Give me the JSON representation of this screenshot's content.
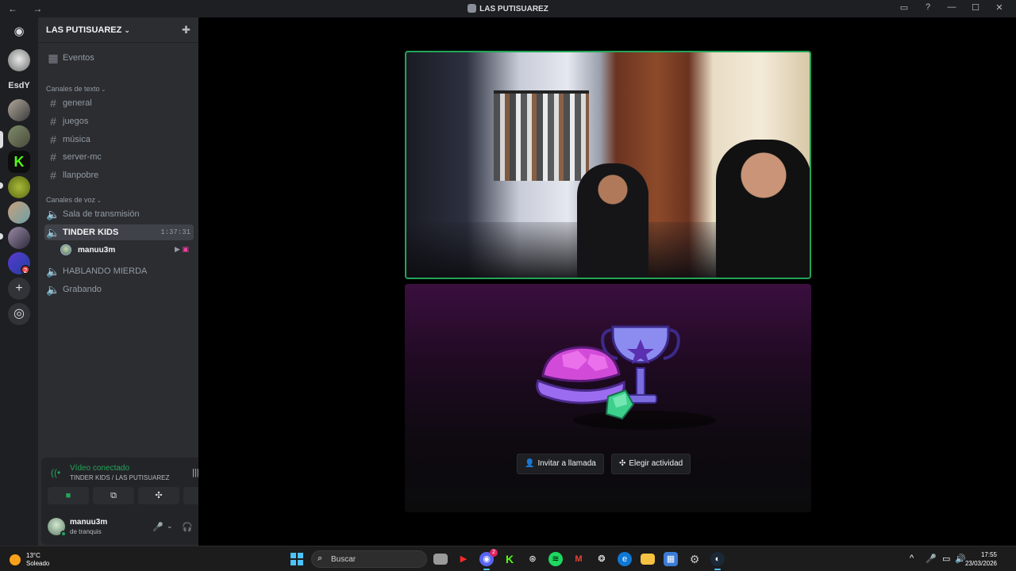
{
  "window": {
    "title": "LAS PUTISUAREZ",
    "nav_glyphs": "← →",
    "controls": {
      "inbox": "▭",
      "help": "?",
      "minimize": "—",
      "maximize": "☐",
      "close": "✕"
    }
  },
  "rail": {
    "home_icon": "◉",
    "folder_label": "EsdY",
    "add_icon": "+",
    "discover_icon": "◎",
    "badge_count": "2"
  },
  "server": {
    "name": "LAS PUTISUAREZ",
    "chevron": "⌄",
    "add_member_icon": "✚",
    "events": {
      "icon": "▦",
      "label": "Eventos"
    }
  },
  "text_category": {
    "label": "Canales de texto",
    "chevron": "⌄"
  },
  "text_channels": [
    {
      "icon": "#",
      "label": "general"
    },
    {
      "icon": "#",
      "label": "juegos"
    },
    {
      "icon": "#",
      "label": "música"
    },
    {
      "icon": "#",
      "label": "server-mc"
    },
    {
      "icon": "#",
      "label": "llanpobre"
    }
  ],
  "voice_category": {
    "label": "Canales de voz",
    "chevron": "⌄"
  },
  "voice_channels": [
    {
      "icon": "🔈",
      "label": "Sala de transmisión"
    },
    {
      "icon": "🔈",
      "label": "TINDER KIDS",
      "timer": "1:37:31"
    },
    {
      "icon": "🔈",
      "label": "HABLANDO MIERDA"
    },
    {
      "icon": "🔈",
      "label": "Grabando"
    }
  ],
  "voice_member": {
    "name": "manuu3m",
    "video_icon": "▶",
    "live_icon": "▣"
  },
  "voice_panel": {
    "status": "Vídeo conectado",
    "location": "TINDER KIDS / LAS PUTISUAREZ",
    "signal_icon": "((•",
    "soundboard_icon": "|||",
    "disconnect_icon": "☎",
    "buttons": {
      "camera": "■",
      "screen": "⧉",
      "activity": "✣",
      "soundboard": "✦"
    }
  },
  "user_panel": {
    "name": "manuu3m",
    "status_text": "de tranquis",
    "mic_icon": "🎤",
    "headset_icon": "🎧",
    "chevron": "⌄",
    "settings_icon": "⚙"
  },
  "activity": {
    "invite_label": "Invitar a llamada",
    "invite_icon": "👤",
    "activity_label": "Elegir actividad",
    "activity_icon": "✣"
  },
  "taskbar": {
    "weather_temp": "13°C",
    "weather_desc": "Soleado",
    "search_placeholder": "Buscar",
    "search_icon": "⌕",
    "discord_badge": "2",
    "tray": {
      "up": "^",
      "mic": "🎤",
      "display": "▭",
      "volume": "🔊"
    },
    "time": "17:55",
    "date": "23/03/2026"
  },
  "colors": {
    "accent_green": "#23a559",
    "sidebar_bg": "#2b2d31",
    "rail_bg": "#1e1f22",
    "activity_purple": "#3a0f3e"
  }
}
